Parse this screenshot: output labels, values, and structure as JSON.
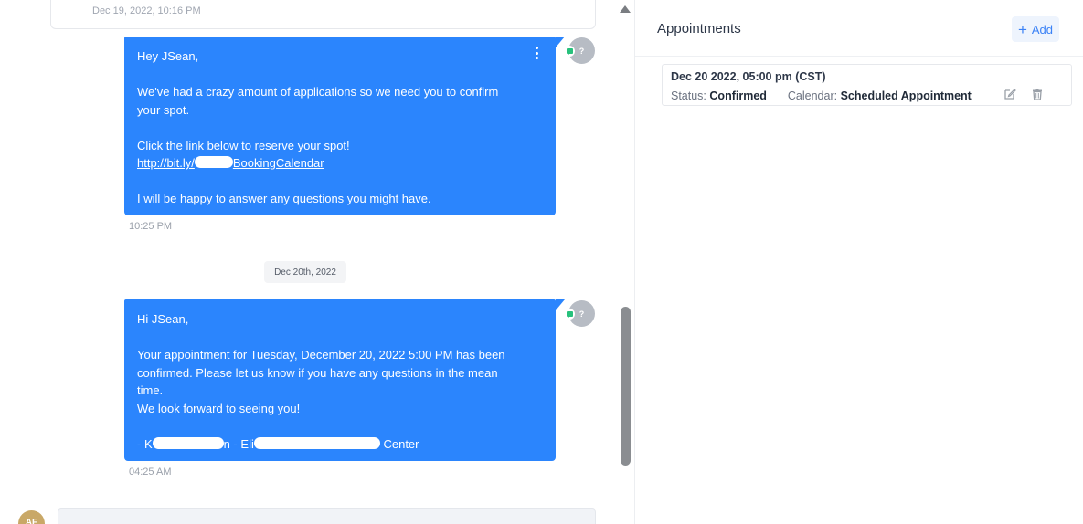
{
  "conversation": {
    "previous_timestamp": "Dec 19, 2022, 10:16 PM",
    "messages": [
      {
        "lines": [
          "Hey JSean,",
          "",
          "We've had a crazy amount of applications so we need you to confirm",
          "your spot.",
          "",
          "Click the link below to reserve your spot!"
        ],
        "link_prefix": "http://bit.ly/",
        "link_suffix": "BookingCalendar",
        "closing": "I will be happy to answer any questions you might have.",
        "time": "10:25 PM",
        "avatar_text": "?"
      },
      {
        "lines": [
          "Hi JSean,",
          "",
          "Your appointment for Tuesday, December 20, 2022 5:00 PM has been",
          "confirmed. Please let us know if you have any questions in the mean",
          "time.",
          "We look forward to seeing you!",
          ""
        ],
        "sig_part1": "- K",
        "sig_part2": "n - Eli",
        "sig_part3": " Center",
        "time": "04:25 AM",
        "avatar_text": "?"
      }
    ],
    "date_separator": "Dec 20th, 2022",
    "next_avatar_initials": "AF"
  },
  "appointments": {
    "title": "Appointments",
    "add_label": "Add",
    "items": [
      {
        "date": "Dec 20 2022, 05:00 pm (CST)",
        "status_label": "Status:",
        "status": "Confirmed",
        "calendar_label": "Calendar:",
        "calendar": "Scheduled Appointment"
      }
    ]
  },
  "colors": {
    "bubble": "#2b85fd",
    "channel_sms": "#27c17c",
    "accent": "#3b82f6"
  },
  "icons": {
    "edit": "edit-icon",
    "delete": "trash-icon",
    "menu": "kebab-menu-icon",
    "channel": "sms-icon"
  }
}
